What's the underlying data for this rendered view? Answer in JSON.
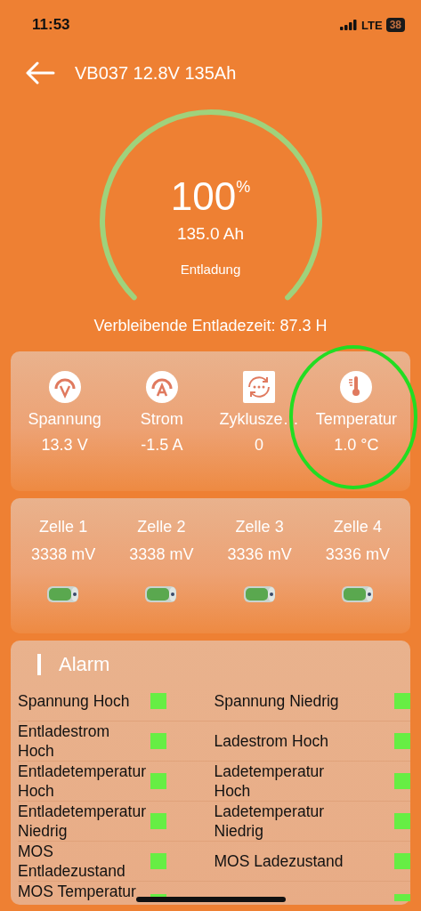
{
  "status_bar": {
    "time": "11:53",
    "network": "LTE",
    "battery": "38"
  },
  "header": {
    "title": "VB037 12.8V 135Ah"
  },
  "gauge": {
    "percent": "100",
    "percent_unit": "%",
    "capacity": "135.0 Ah",
    "mode": "Entladung"
  },
  "remaining_time": "Verbleibende Entladezeit: 87.3 H",
  "metrics": [
    {
      "kind": "voltage",
      "label": "Spannung",
      "value": "13.3 V"
    },
    {
      "kind": "current",
      "label": "Strom",
      "value": "-1.5 A"
    },
    {
      "kind": "cycles",
      "label": "Zyklusze…",
      "value": "0"
    },
    {
      "kind": "temperature",
      "label": "Temperatur",
      "value": "1.0 °C",
      "highlighted": true
    }
  ],
  "cells": [
    {
      "label": "Zelle 1",
      "value": "3338 mV"
    },
    {
      "label": "Zelle 2",
      "value": "3338 mV"
    },
    {
      "label": "Zelle 3",
      "value": "3336 mV"
    },
    {
      "label": "Zelle 4",
      "value": "3336 mV"
    }
  ],
  "alarm": {
    "title": "Alarm",
    "items": [
      {
        "label": "Spannung Hoch",
        "color": "#66ee44"
      },
      {
        "label": "Spannung Niedrig",
        "color": "#66ee44"
      },
      {
        "label": "Entladestrom Hoch",
        "color": "#66ee44"
      },
      {
        "label": "Ladestrom Hoch",
        "color": "#66ee44"
      },
      {
        "label": "Entladetemperatur Hoch",
        "color": "#66ee44"
      },
      {
        "label": "Ladetemperatur Hoch",
        "color": "#66ee44"
      },
      {
        "label": "Entladetemperatur Niedrig",
        "color": "#66ee44"
      },
      {
        "label": "Ladetemperatur Niedrig",
        "color": "#66ee44"
      },
      {
        "label": "MOS Entladezustand",
        "color": "#66ee44"
      },
      {
        "label": "MOS Ladezustand",
        "color": "#66ee44"
      },
      {
        "label": "MOS Temperatur",
        "color": "#66ee44"
      },
      {
        "color": "#66ee44"
      }
    ]
  }
}
